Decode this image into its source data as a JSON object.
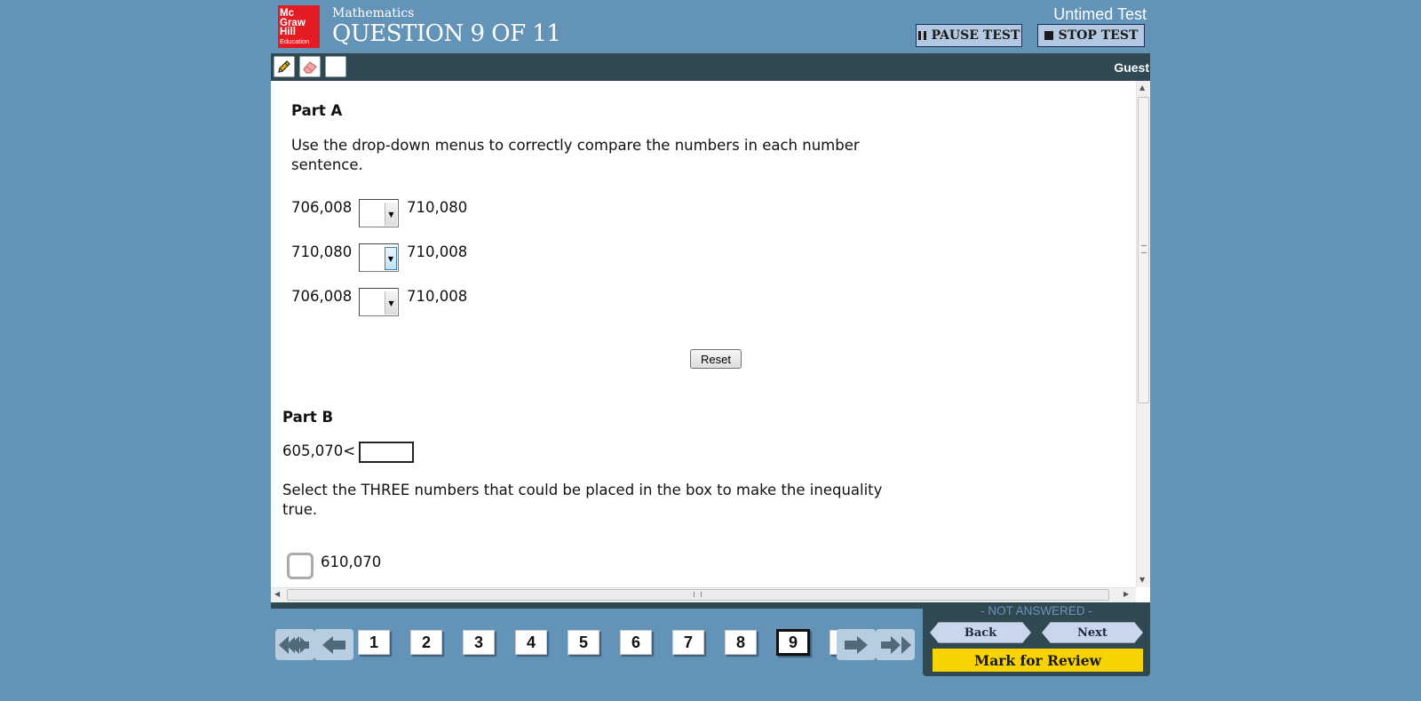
{
  "header": {
    "logo_lines": [
      "Mc",
      "Graw",
      "Hill",
      "Education"
    ],
    "subject": "Mathematics",
    "question_title": "QUESTION 9 OF 11",
    "timing": "Untimed Test",
    "pause_label": "PAUSE TEST",
    "stop_label": "STOP TEST"
  },
  "toolbar": {
    "tools": [
      "pencil-icon",
      "eraser-icon",
      "blank-tool"
    ],
    "user": "Guest"
  },
  "part_a": {
    "heading": "Part A",
    "instructions_line1": "Use the drop-down menus to correctly compare the numbers in each number",
    "instructions_line2": "sentence.",
    "sentences": [
      {
        "left": "706,008",
        "right": "710,080",
        "selected": ""
      },
      {
        "left": "710,080",
        "right": "710,008",
        "selected": ""
      },
      {
        "left": "706,008",
        "right": "710,008",
        "selected": ""
      }
    ],
    "reset_label": "Reset"
  },
  "part_b": {
    "heading": "Part B",
    "inequality_prefix": "605,070<",
    "instructions_line1": "Select the THREE numbers that could be placed in the box to make the inequality",
    "instructions_line2": "true.",
    "options": [
      {
        "label": "610,070",
        "checked": false
      }
    ]
  },
  "footer": {
    "status": "- NOT ANSWERED -",
    "back_label": "Back",
    "next_label": "Next",
    "review_label": "Mark for Review",
    "questions": [
      "1",
      "2",
      "3",
      "4",
      "5",
      "6",
      "7",
      "8",
      "9"
    ],
    "current_question": "9"
  },
  "colors": {
    "background": "#6394b7",
    "toolbar": "#2f4852",
    "logo_red": "#e31b23",
    "review_yellow": "#f7d302",
    "status_blue": "#6f93b6"
  }
}
